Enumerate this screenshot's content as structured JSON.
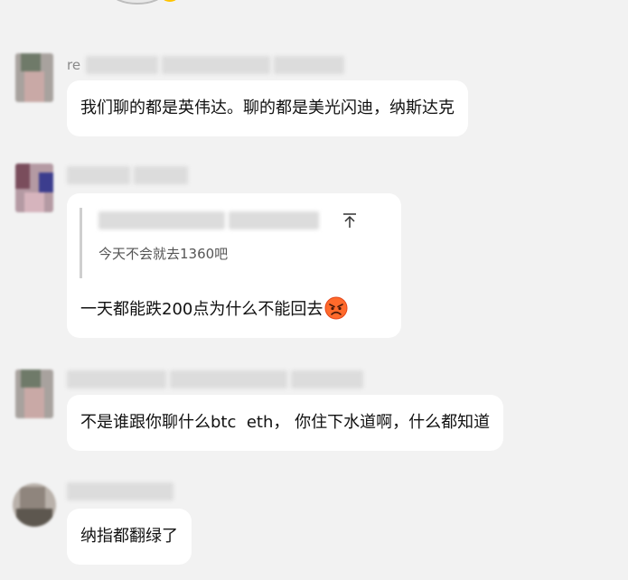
{
  "messages": [
    {
      "sender": "re",
      "text": "我们聊的都是英伟达。聊的都是美光闪迪，纳斯达克"
    },
    {
      "quote": {
        "text": "今天不会就去1360吧",
        "arrow_icon": "arrow-to-top-icon"
      },
      "text": "一天都能跌200点为什么不能回去",
      "emoji": "angry-face-icon"
    },
    {
      "text": "不是谁跟你聊什么btc  eth， 你住下水道啊，什么都知道"
    },
    {
      "text": "纳指都翻绿了"
    }
  ],
  "colors": {
    "background": "#f2f2f2",
    "bubble": "#ffffff",
    "text": "#111111",
    "sender_name": "#8a8a8a",
    "quote_bar": "#cfcfcf",
    "quote_text": "#555555"
  }
}
